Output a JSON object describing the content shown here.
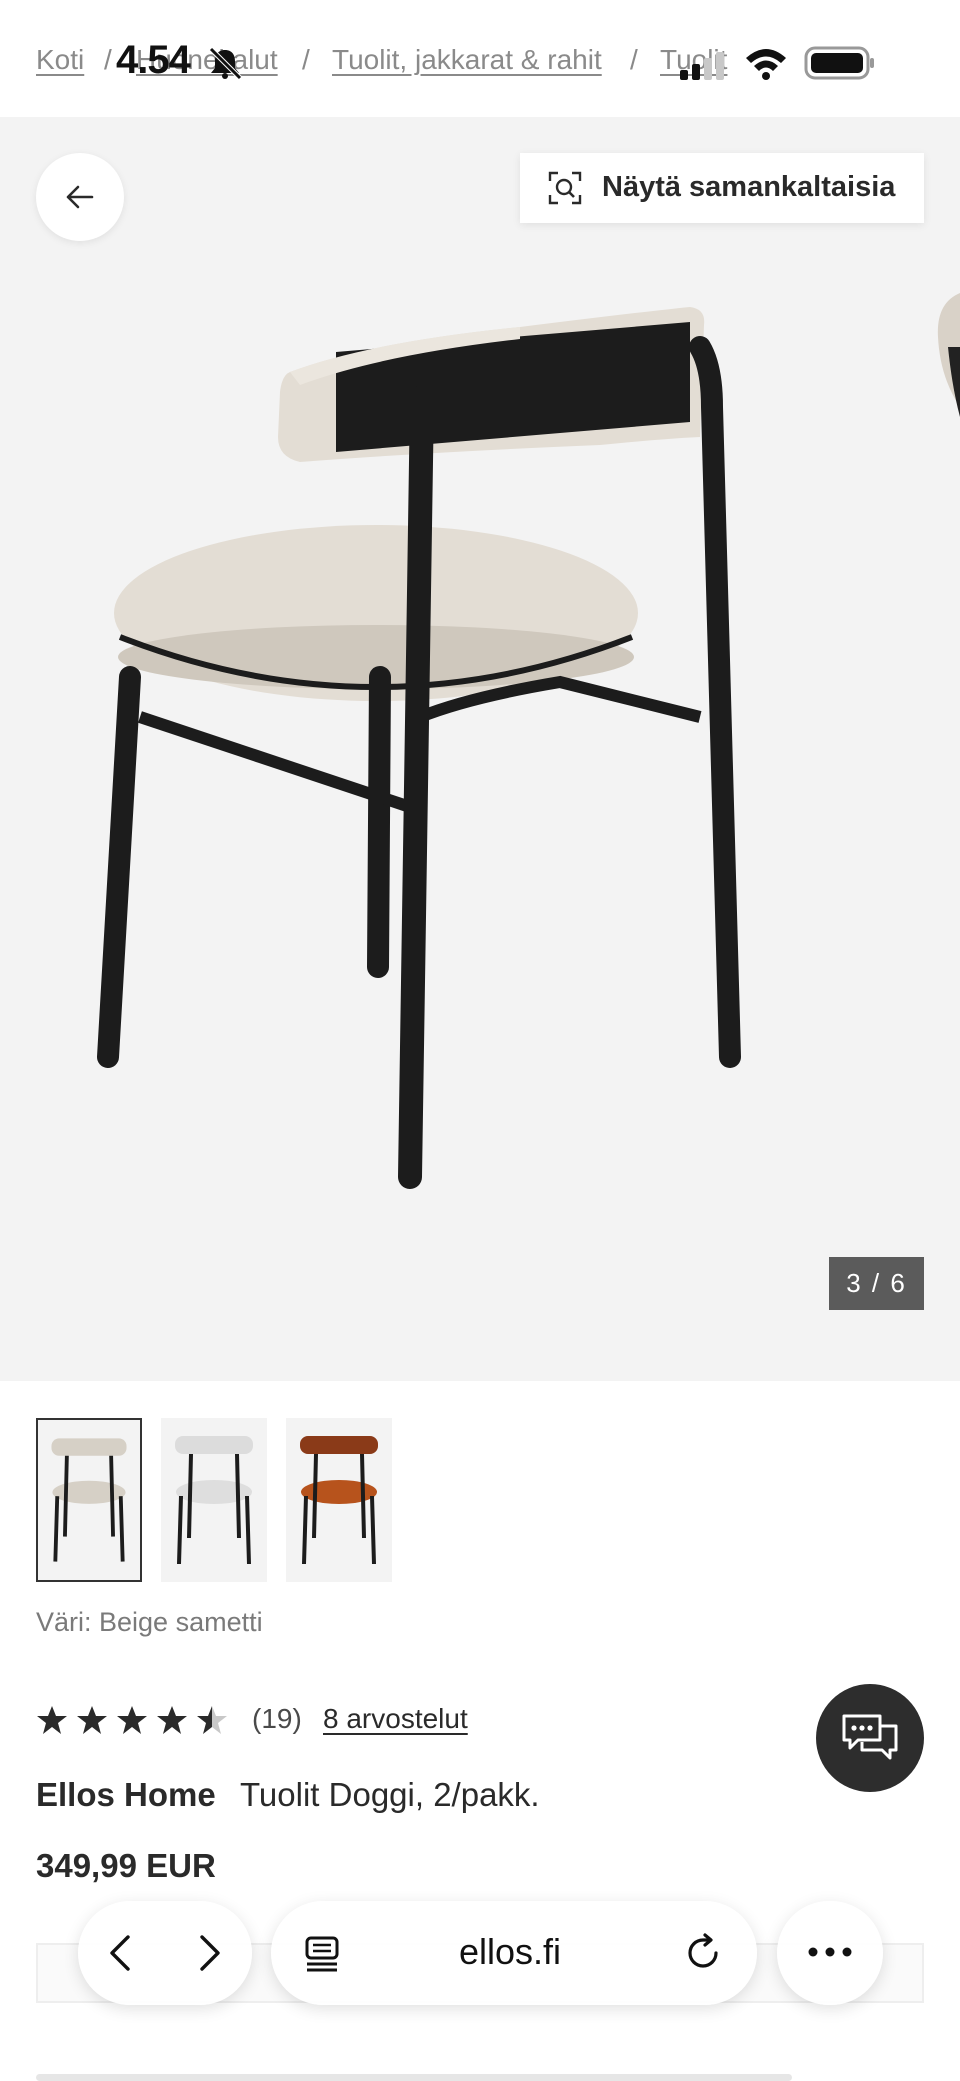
{
  "status_bar": {
    "time": "4.54"
  },
  "breadcrumb": {
    "items": [
      "Koti",
      "Huonekalut",
      "Tuolit, jakkarat & rahit",
      "Tuolit"
    ],
    "separator": "/"
  },
  "gallery": {
    "similar_button_label": "Näytä samankaltaisia",
    "counter": "3 / 6",
    "thumbnails": [
      {
        "name": "Beige samettia",
        "selected": true
      },
      {
        "name": "Harmaa",
        "selected": false
      },
      {
        "name": "Ruoste",
        "selected": false
      }
    ]
  },
  "product": {
    "color_label": "Väri: Beige sametti",
    "rating": 4.5,
    "rating_count": "(19)",
    "reviews_link": "8 arvostelut",
    "brand": "Ellos Home",
    "name": "Tuolit Doggi, 2/pakk.",
    "price": "349,99 EUR"
  },
  "browser": {
    "url": "ellos.fi"
  },
  "colors": {
    "accent_dark": "#2d2d2d",
    "gallery_bg": "#f3f3f3",
    "counter_bg": "#5b5b5b",
    "seat_beige": "#e3ddd4",
    "seat_rust": "#b7531c"
  }
}
